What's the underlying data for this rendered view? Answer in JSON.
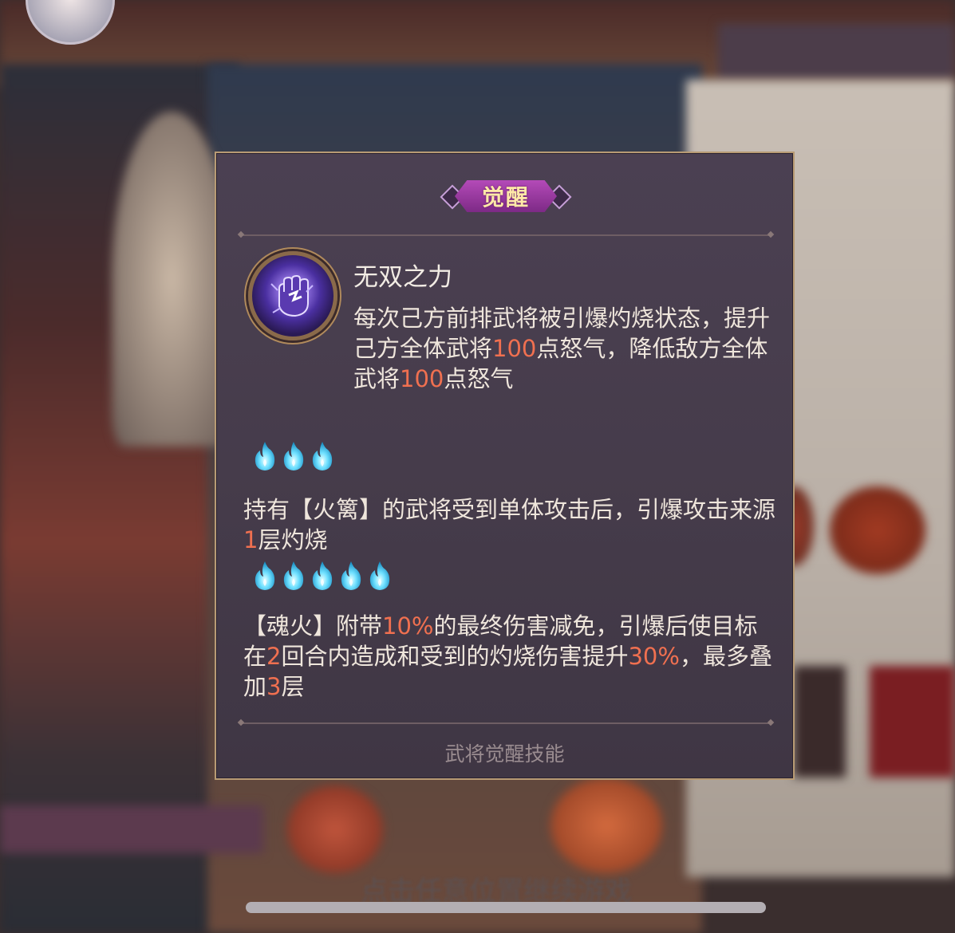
{
  "background": {
    "hint_text": "点击任意位置继续游戏"
  },
  "dialog": {
    "badge": "觉醒",
    "skill": {
      "icon": "fist-lightning-icon",
      "name": "无双之力",
      "desc_parts": [
        "每次己方前排武将被引爆灼烧状态，提升己方全体武将",
        "100",
        "点怒气，降低敌方全体武将",
        "100",
        "点怒气"
      ]
    },
    "tier1": {
      "flame_icon": "blue-soul-flame-icon",
      "flame_count": 3,
      "parts": [
        "持有【火篱】的武将受到单体攻击后，引爆攻击来源",
        "1",
        "层灼烧"
      ]
    },
    "tier2": {
      "flame_icon": "blue-soul-flame-icon",
      "flame_count": 5,
      "parts": [
        "【魂火】附带",
        "10%",
        "的最终伤害减免，引爆后使目标在",
        "2",
        "回合内造成和受到的灼烧伤害提升",
        "30%",
        "，最多叠加",
        "3",
        "层"
      ]
    },
    "footer": "武将觉醒技能"
  },
  "colors": {
    "highlight": "#f07050",
    "text": "#efe6dc",
    "border": "#b89b74",
    "badge": "#9a3aa0"
  }
}
